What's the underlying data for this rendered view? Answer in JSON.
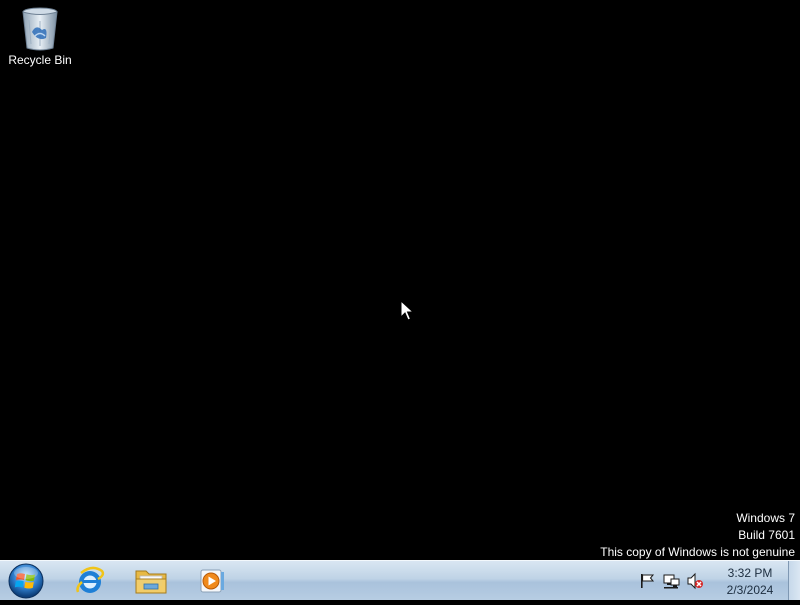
{
  "desktop": {
    "icons": [
      {
        "label": "Recycle Bin",
        "icon": "recycle-bin-icon"
      }
    ],
    "watermark": {
      "line1": "Windows 7",
      "line2": "Build 7601",
      "line3": "This copy of Windows is not genuine"
    }
  },
  "taskbar": {
    "start": {
      "icon": "windows-orb-icon"
    },
    "pinned": [
      {
        "icon": "internet-explorer-icon"
      },
      {
        "icon": "folder-icon"
      },
      {
        "icon": "media-player-icon"
      }
    ],
    "tray": {
      "icons": [
        "action-center-flag-icon",
        "network-icon",
        "volume-muted-icon"
      ],
      "time": "3:32 PM",
      "date": "2/3/2024"
    }
  },
  "colors": {
    "desktop_background": "#000000",
    "taskbar": "#bfd3e6",
    "text_light": "#ffffff",
    "text_dark": "#1c2d3f"
  }
}
